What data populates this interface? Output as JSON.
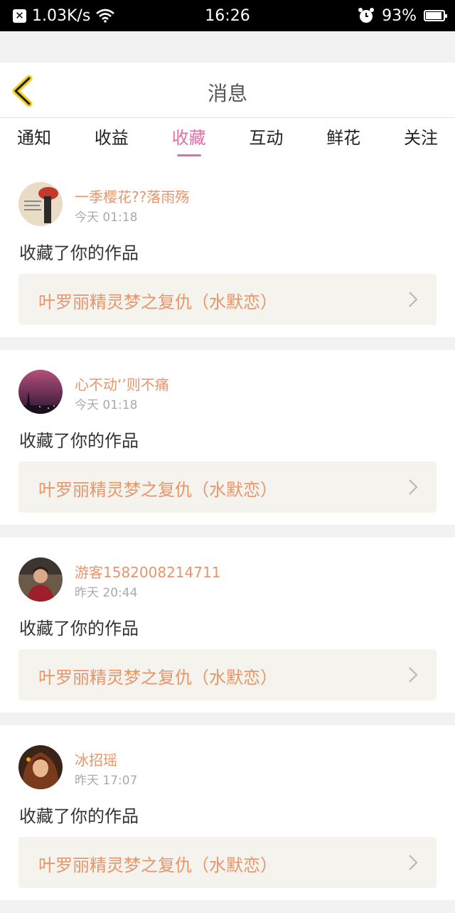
{
  "status_bar": {
    "speed": "1.03K/s",
    "time": "16:26",
    "battery": "93%",
    "battery_level": 0.93,
    "icons": [
      "notification-x-icon",
      "wifi-icon",
      "alarm-icon",
      "battery-icon"
    ]
  },
  "header": {
    "title": "消息",
    "back_icon": "chevron-left-icon"
  },
  "tabs": [
    {
      "label": "通知",
      "active": false
    },
    {
      "label": "收益",
      "active": false
    },
    {
      "label": "收藏",
      "active": true
    },
    {
      "label": "互动",
      "active": false
    },
    {
      "label": "鲜花",
      "active": false
    },
    {
      "label": "关注",
      "active": false
    }
  ],
  "colors": {
    "accent_pink": "#e06fa5",
    "accent_orange": "#e8956a",
    "back_icon_yellow": "#f0cf28"
  },
  "messages": [
    {
      "user": "一季樱花??落雨殇",
      "time": "今天 01:18",
      "action": "收藏了你的作品",
      "work": "叶罗丽精灵梦之复仇（水默恋）"
    },
    {
      "user": "心不动‘’则不痛",
      "time": "今天 01:18",
      "action": "收藏了你的作品",
      "work": "叶罗丽精灵梦之复仇（水默恋）"
    },
    {
      "user": "游客1582008214711",
      "time": "昨天 20:44",
      "action": "收藏了你的作品",
      "work": "叶罗丽精灵梦之复仇（水默恋）"
    },
    {
      "user": "冰招瑶",
      "time": "昨天 17:07",
      "action": "收藏了你的作品",
      "work": "叶罗丽精灵梦之复仇（水默恋）"
    }
  ]
}
